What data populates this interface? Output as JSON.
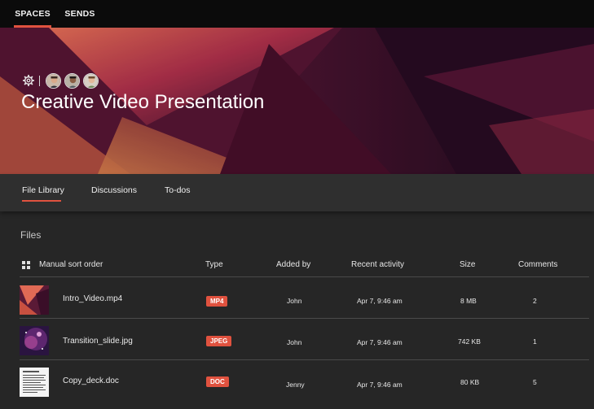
{
  "topnav": {
    "tabs": [
      {
        "label": "SPACES",
        "active": true
      },
      {
        "label": "SENDS",
        "active": false
      }
    ]
  },
  "hero": {
    "title": "Creative Video Presentation",
    "avatars": [
      "person-avatar-1",
      "person-avatar-2",
      "person-avatar-3"
    ]
  },
  "subnav": {
    "tabs": [
      {
        "label": "File Library",
        "active": true
      },
      {
        "label": "Discussions",
        "active": false
      },
      {
        "label": "To-dos",
        "active": false
      }
    ]
  },
  "files": {
    "section_title": "Files",
    "columns": {
      "name": "Manual sort order",
      "type": "Type",
      "added_by": "Added by",
      "recent_activity": "Recent activity",
      "size": "Size",
      "comments": "Comments"
    },
    "rows": [
      {
        "name": "Intro_Video.mp4",
        "type": "MP4",
        "added_by": "John",
        "recent_activity": "Apr 7, 9:46 am",
        "size": "8 MB",
        "comments": "2"
      },
      {
        "name": "Transition_slide.jpg",
        "type": "JPEG",
        "added_by": "John",
        "recent_activity": "Apr 7, 9:46 am",
        "size": "742 KB",
        "comments": "1"
      },
      {
        "name": "Copy_deck.doc",
        "type": "DOC",
        "added_by": "Jenny",
        "recent_activity": "Apr 7, 9:46 am",
        "size": "80 KB",
        "comments": "5"
      }
    ]
  },
  "colors": {
    "accent": "#e0523f",
    "background": "#262626",
    "topbar": "#0b0b0b"
  }
}
